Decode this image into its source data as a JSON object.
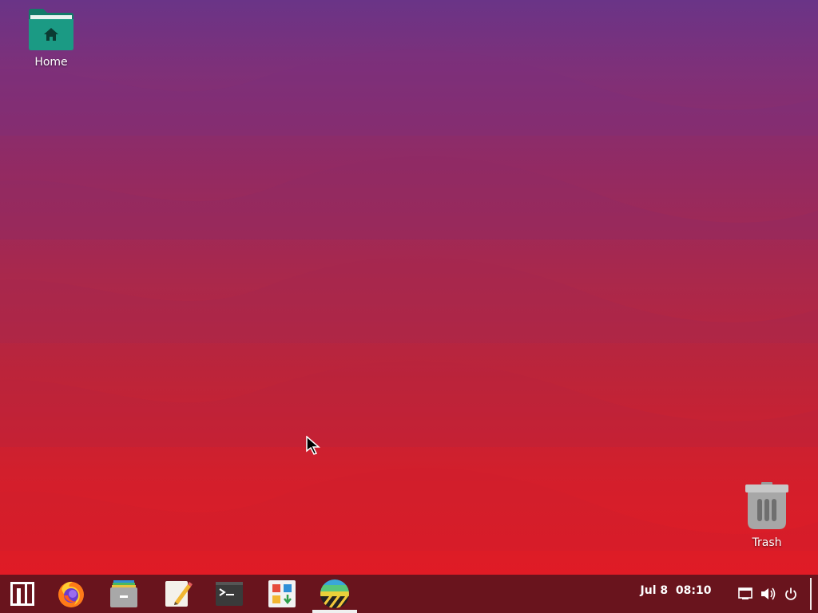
{
  "desktop": {
    "icons": [
      {
        "label": "Home",
        "icon": "home-folder-icon"
      },
      {
        "label": "Trash",
        "icon": "trash-icon"
      }
    ],
    "wallpaper_colors": [
      "#6a3487",
      "#932a62",
      "#bd2439",
      "#e01b25"
    ]
  },
  "taskbar": {
    "background": "#69141d",
    "launchers": [
      {
        "name": "menu-launcher-icon"
      },
      {
        "name": "firefox-icon"
      },
      {
        "name": "file-manager-icon"
      },
      {
        "name": "text-editor-icon"
      },
      {
        "name": "terminal-icon"
      },
      {
        "name": "software-manager-icon"
      },
      {
        "name": "active-app-icon",
        "active": true
      }
    ],
    "clock": "Jul 8  08:10",
    "tray": [
      "network-icon",
      "volume-icon",
      "power-icon"
    ]
  }
}
